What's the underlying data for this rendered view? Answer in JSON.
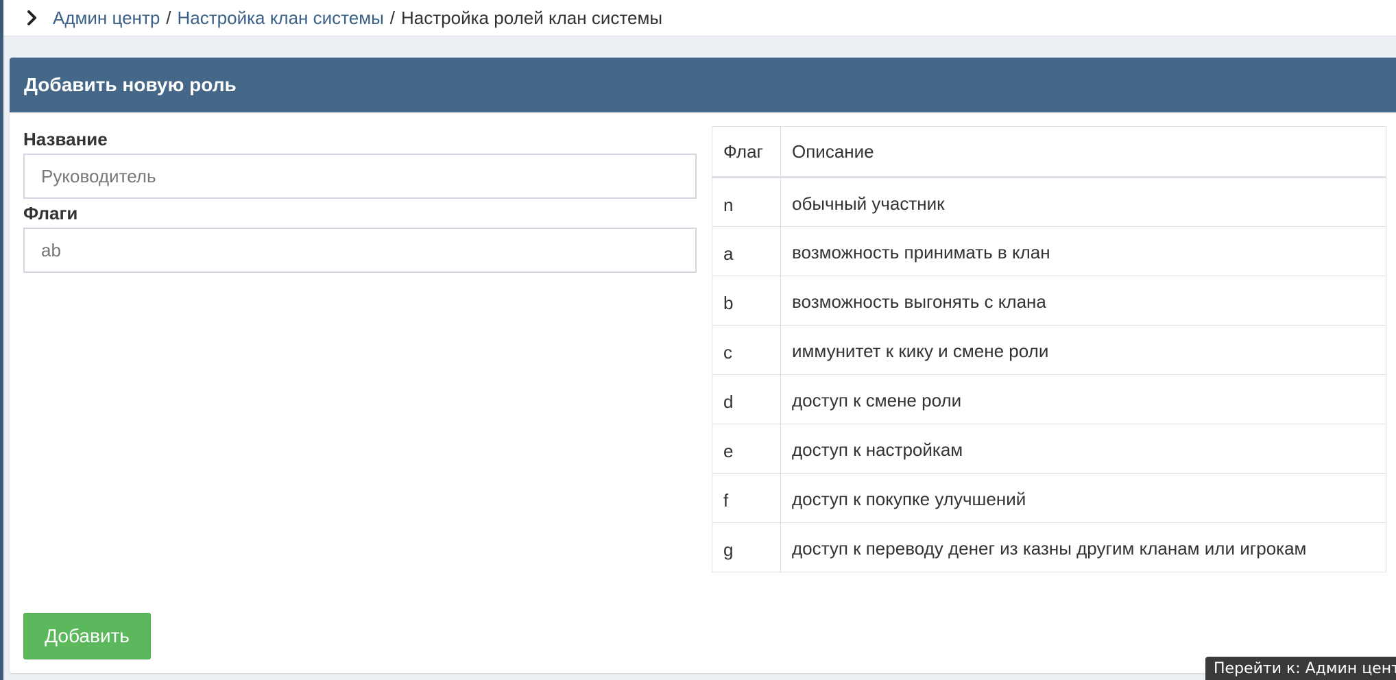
{
  "breadcrumb": {
    "items": [
      {
        "label": "Админ центр"
      },
      {
        "label": "Настройка клан системы"
      }
    ],
    "separator": "/",
    "current": "Настройка ролей клан системы"
  },
  "form_box": {
    "title": "Добавить новую роль",
    "name_label": "Название",
    "name_placeholder": "Руководитель",
    "flags_label": "Флаги",
    "flags_placeholder": "ab",
    "submit_label": "Добавить"
  },
  "flags_table": {
    "headers": [
      "Флаг",
      "Описание"
    ],
    "rows": [
      {
        "flag": "n",
        "description": "обычный участник"
      },
      {
        "flag": "a",
        "description": "возможность принимать в клан"
      },
      {
        "flag": "b",
        "description": "возможность выгонять с клана"
      },
      {
        "flag": "c",
        "description": "иммунитет к кику и смене роли"
      },
      {
        "flag": "d",
        "description": "доступ к смене роли"
      },
      {
        "flag": "e",
        "description": "доступ к настройкам"
      },
      {
        "flag": "f",
        "description": "доступ к покупке улучшений"
      },
      {
        "flag": "g",
        "description": "доступ к переводу денег из казны другим кланам или игрокам"
      }
    ]
  },
  "status_tooltip": "Перейти к: Админ центр",
  "colors": {
    "header_bg": "#456788",
    "link": "#3c6188",
    "button_bg": "#5cb85c",
    "page_bg": "#ecf0f5"
  },
  "icons": {
    "breadcrumb_prefix": "chevron-right-icon"
  }
}
